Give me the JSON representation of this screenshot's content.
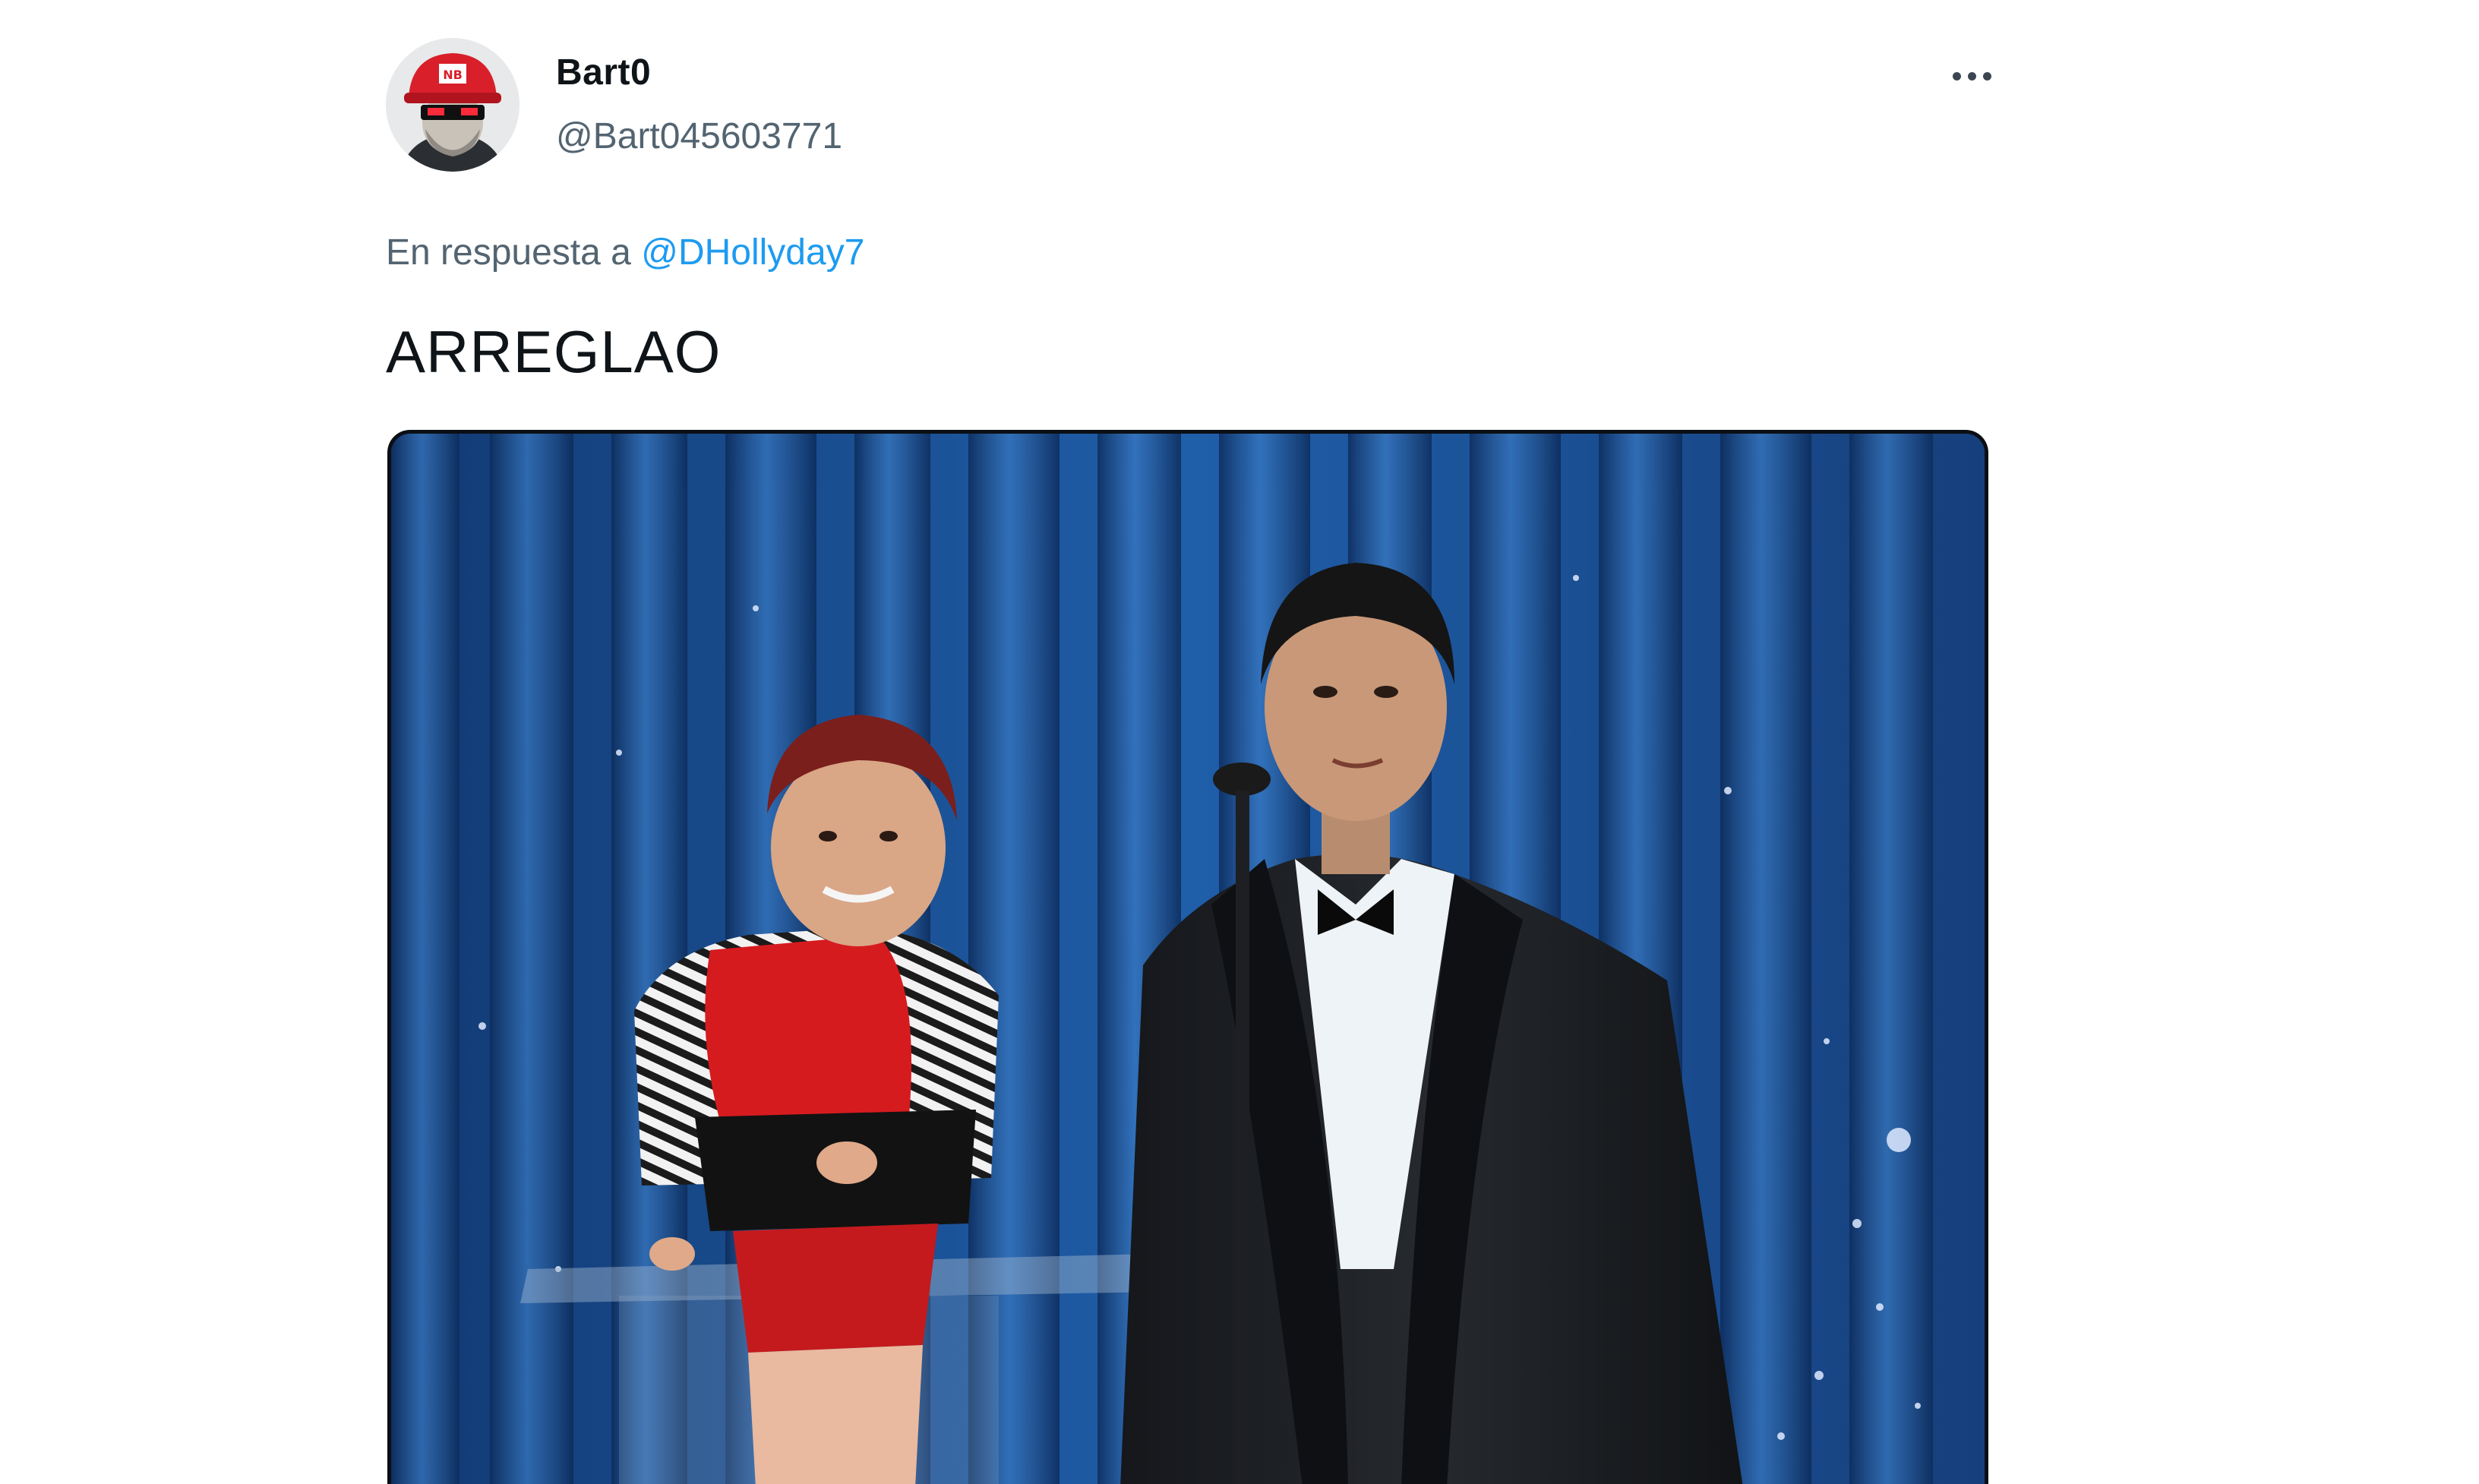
{
  "tweet": {
    "author": {
      "display_name": "Bart0",
      "handle": "@Bart045603771",
      "avatar_icon": "user-avatar-red-cap-sunglasses"
    },
    "more_icon": "more-horizontal-icon",
    "reply": {
      "prefix": "En respuesta a",
      "mention": "@DHollyday7"
    },
    "text": "ARREGLAO",
    "media": {
      "description_icon": "photo-ventriloquist-stage"
    },
    "colors": {
      "link": "#1d9bf0",
      "secondary_text": "#536471",
      "primary_text": "#0f1419"
    }
  }
}
